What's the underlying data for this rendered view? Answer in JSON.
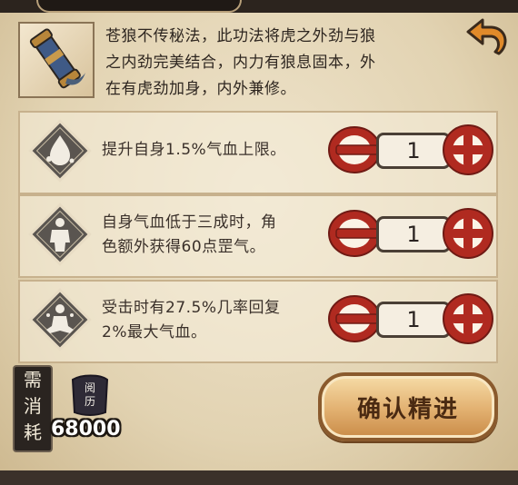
{
  "description": {
    "lines": [
      "苍狼不传秘法，此功法将虎之外劲与狼",
      "之内劲完美结合，内力有狼息固本，外",
      "在有虎劲加身，内外兼修。"
    ]
  },
  "options": [
    {
      "icon": "water-drop-icon",
      "lines": [
        "提升自身1.5%气血上限。"
      ],
      "quantity": "1"
    },
    {
      "icon": "body-figure-icon",
      "lines": [
        "自身气血低于三成时，角",
        "色额外获得60点罡气。"
      ],
      "quantity": "1"
    },
    {
      "icon": "meditation-figure-icon",
      "lines": [
        "受击时有27.5%几率回复",
        "2%最大气血。"
      ],
      "quantity": "1"
    }
  ],
  "cost": {
    "label_chars": [
      "需",
      "消",
      "耗"
    ],
    "currency_name": "阅历",
    "amount": "68000"
  },
  "confirm_label": "确认精进"
}
